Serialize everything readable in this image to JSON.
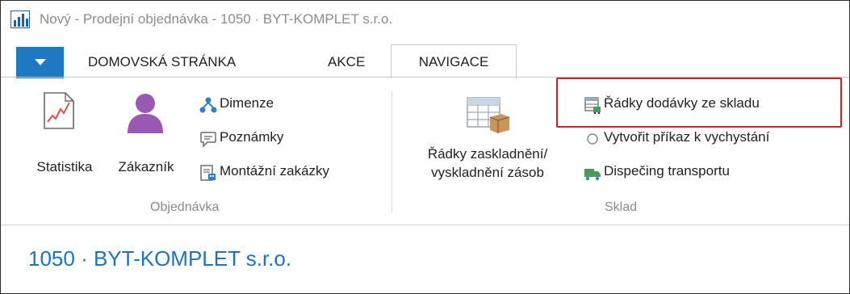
{
  "window": {
    "title": "Nový - Prodejní objednávka - 1050 · BYT-KOMPLET s.r.o.",
    "accent": "#1e78c2"
  },
  "tabs": [
    {
      "label": "DOMOVSKÁ STRÁNKA",
      "active": false
    },
    {
      "label": "AKCE",
      "active": false
    },
    {
      "label": "NAVIGACE",
      "active": true
    }
  ],
  "ribbon": {
    "groups": [
      {
        "label": "Objednávka",
        "big_buttons": [
          {
            "label": "Statistika",
            "icon": "chart-icon"
          },
          {
            "label": "Zákazník",
            "icon": "person-icon"
          }
        ],
        "small_buttons": [
          {
            "label": "Dimenze",
            "icon": "dimensions-icon"
          },
          {
            "label": "Poznámky",
            "icon": "speech-bubble-icon"
          },
          {
            "label": "Montážní zakázky",
            "icon": "assembly-icon"
          }
        ]
      },
      {
        "label": "Sklad",
        "big_buttons": [
          {
            "label_line1": "Řádky zaskladnění/",
            "label_line2": "vyskladnění zásob",
            "icon": "warehouse-grid-icon"
          }
        ],
        "small_buttons": [
          {
            "label": "Řádky dodávky ze skladu",
            "icon": "shipment-lines-icon",
            "highlighted": true
          },
          {
            "label": "Vytvořit příkaz k vychystání",
            "icon": "circle-icon"
          },
          {
            "label": "Dispečing transportu",
            "icon": "truck-icon"
          }
        ]
      }
    ],
    "highlight_color": "#c0262d"
  },
  "page": {
    "title": "1050 · BYT-KOMPLET s.r.o.",
    "title_color": "#1e73be"
  }
}
